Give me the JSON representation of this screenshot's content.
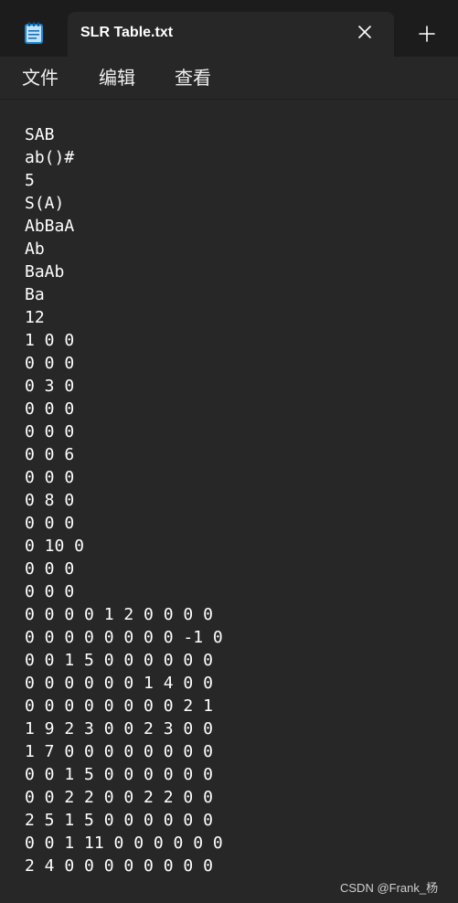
{
  "window": {
    "tab_title": "SLR Table.txt",
    "icons": {
      "app": "notepad-icon",
      "close": "close-icon",
      "new_tab": "plus-icon"
    }
  },
  "menu": {
    "items": [
      "文件",
      "编辑",
      "查看"
    ]
  },
  "editor": {
    "lines": [
      "SAB",
      "ab()#",
      "5",
      "S(A)",
      "AbBaA",
      "Ab",
      "BaAb",
      "Ba",
      "12",
      "1 0 0",
      "0 0 0",
      "0 3 0",
      "0 0 0",
      "0 0 0",
      "0 0 6",
      "0 0 0",
      "0 8 0",
      "0 0 0",
      "0 10 0",
      "0 0 0",
      "0 0 0",
      "0 0 0 0 1 2 0 0 0 0",
      "0 0 0 0 0 0 0 0 -1 0",
      "0 0 1 5 0 0 0 0 0 0",
      "0 0 0 0 0 0 1 4 0 0",
      "0 0 0 0 0 0 0 0 2 1",
      "1 9 2 3 0 0 2 3 0 0",
      "1 7 0 0 0 0 0 0 0 0",
      "0 0 1 5 0 0 0 0 0 0",
      "0 0 2 2 0 0 2 2 0 0",
      "2 5 1 5 0 0 0 0 0 0",
      "0 0 1 11 0 0 0 0 0 0",
      "2 4 0 0 0 0 0 0 0 0"
    ]
  },
  "watermark": "CSDN @Frank_杨",
  "colors": {
    "titlebar": "#1c1c1c",
    "background": "#272727",
    "text": "#ffffff",
    "icon_blue": "#1e88d4"
  }
}
